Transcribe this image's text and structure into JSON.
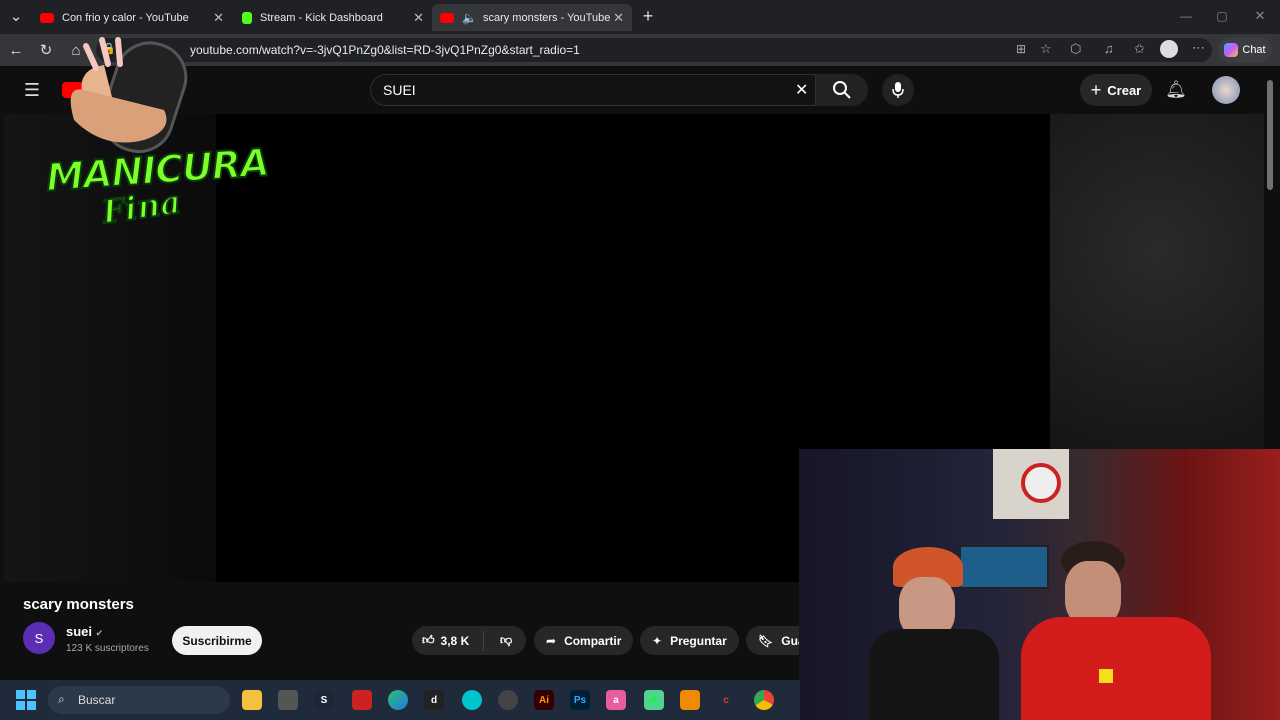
{
  "tabs": [
    {
      "title": "Con frio y calor - YouTube",
      "favicon_color": "#ff0000"
    },
    {
      "title": "Stream - Kick Dashboard",
      "favicon_color": "#53fc18"
    },
    {
      "title": "scary monsters - YouTube",
      "favicon_color": "#ff0000"
    }
  ],
  "address": {
    "url": "youtube.com/watch?v=-3jvQ1PnZg0&list=RD-3jvQ1PnZg0&start_radio=1"
  },
  "browser": {
    "chat_label": "Chat"
  },
  "youtube": {
    "search_value": "SUEI",
    "create_label": "Crear",
    "video_title": "scary monsters",
    "channel_initial": "S",
    "channel_name": "suei",
    "subscribers": "123 K suscriptores",
    "subscribe_label": "Suscribirme",
    "likes": "3,8 K",
    "share_label": "Compartir",
    "ask_label": "Preguntar",
    "save_label": "Gua"
  },
  "overlay": {
    "logo_line1": "MANICURA",
    "logo_line2": "Fina"
  },
  "taskbar": {
    "search_placeholder": "Buscar"
  },
  "colors": {
    "yt_red": "#ff0000",
    "kick_green": "#53fc18",
    "logo_green": "#7dff2a"
  }
}
